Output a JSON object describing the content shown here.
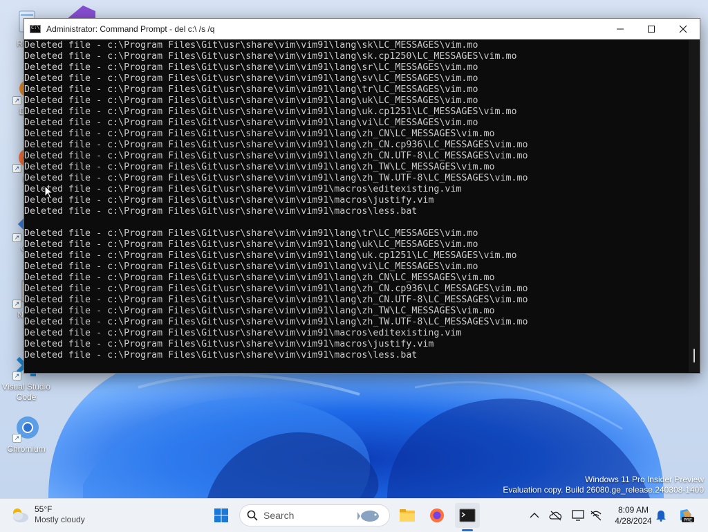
{
  "window": {
    "title": "Administrator: Command Prompt - del  c:\\ /s /q",
    "minimize_icon": "minimize-icon",
    "maximize_icon": "maximize-icon",
    "close_icon": "close-icon"
  },
  "console": {
    "lines": [
      "Deleted file - c:\\Program Files\\Git\\usr\\share\\vim\\vim91\\lang\\sk\\LC_MESSAGES\\vim.mo",
      "Deleted file - c:\\Program Files\\Git\\usr\\share\\vim\\vim91\\lang\\sk.cp1250\\LC_MESSAGES\\vim.mo",
      "Deleted file - c:\\Program Files\\Git\\usr\\share\\vim\\vim91\\lang\\sr\\LC_MESSAGES\\vim.mo",
      "Deleted file - c:\\Program Files\\Git\\usr\\share\\vim\\vim91\\lang\\sv\\LC_MESSAGES\\vim.mo",
      "Deleted file - c:\\Program Files\\Git\\usr\\share\\vim\\vim91\\lang\\tr\\LC_MESSAGES\\vim.mo",
      "Deleted file - c:\\Program Files\\Git\\usr\\share\\vim\\vim91\\lang\\uk\\LC_MESSAGES\\vim.mo",
      "Deleted file - c:\\Program Files\\Git\\usr\\share\\vim\\vim91\\lang\\uk.cp1251\\LC_MESSAGES\\vim.mo",
      "Deleted file - c:\\Program Files\\Git\\usr\\share\\vim\\vim91\\lang\\vi\\LC_MESSAGES\\vim.mo",
      "Deleted file - c:\\Program Files\\Git\\usr\\share\\vim\\vim91\\lang\\zh_CN\\LC_MESSAGES\\vim.mo",
      "Deleted file - c:\\Program Files\\Git\\usr\\share\\vim\\vim91\\lang\\zh_CN.cp936\\LC_MESSAGES\\vim.mo",
      "Deleted file - c:\\Program Files\\Git\\usr\\share\\vim\\vim91\\lang\\zh_CN.UTF-8\\LC_MESSAGES\\vim.mo",
      "Deleted file - c:\\Program Files\\Git\\usr\\share\\vim\\vim91\\lang\\zh_TW\\LC_MESSAGES\\vim.mo",
      "Deleted file - c:\\Program Files\\Git\\usr\\share\\vim\\vim91\\lang\\zh_TW.UTF-8\\LC_MESSAGES\\vim.mo",
      "Deleted file - c:\\Program Files\\Git\\usr\\share\\vim\\vim91\\macros\\editexisting.vim",
      "Deleted file - c:\\Program Files\\Git\\usr\\share\\vim\\vim91\\macros\\justify.vim",
      "Deleted file - c:\\Program Files\\Git\\usr\\share\\vim\\vim91\\macros\\less.bat",
      "",
      "Deleted file - c:\\Program Files\\Git\\usr\\share\\vim\\vim91\\lang\\tr\\LC_MESSAGES\\vim.mo",
      "Deleted file - c:\\Program Files\\Git\\usr\\share\\vim\\vim91\\lang\\uk\\LC_MESSAGES\\vim.mo",
      "Deleted file - c:\\Program Files\\Git\\usr\\share\\vim\\vim91\\lang\\uk.cp1251\\LC_MESSAGES\\vim.mo",
      "Deleted file - c:\\Program Files\\Git\\usr\\share\\vim\\vim91\\lang\\vi\\LC_MESSAGES\\vim.mo",
      "Deleted file - c:\\Program Files\\Git\\usr\\share\\vim\\vim91\\lang\\zh_CN\\LC_MESSAGES\\vim.mo",
      "Deleted file - c:\\Program Files\\Git\\usr\\share\\vim\\vim91\\lang\\zh_CN.cp936\\LC_MESSAGES\\vim.mo",
      "Deleted file - c:\\Program Files\\Git\\usr\\share\\vim\\vim91\\lang\\zh_CN.UTF-8\\LC_MESSAGES\\vim.mo",
      "Deleted file - c:\\Program Files\\Git\\usr\\share\\vim\\vim91\\lang\\zh_TW\\LC_MESSAGES\\vim.mo",
      "Deleted file - c:\\Program Files\\Git\\usr\\share\\vim\\vim91\\lang\\zh_TW.UTF-8\\LC_MESSAGES\\vim.mo",
      "Deleted file - c:\\Program Files\\Git\\usr\\share\\vim\\vim91\\macros\\editexisting.vim",
      "Deleted file - c:\\Program Files\\Git\\usr\\share\\vim\\vim91\\macros\\justify.vim",
      "Deleted file - c:\\Program Files\\Git\\usr\\share\\vim\\vim91\\macros\\less.bat"
    ]
  },
  "desktop": {
    "icons": [
      {
        "label": "Recy",
        "icon": "recycle-bin-icon"
      },
      {
        "label": "Eve",
        "icon": "everything-icon"
      },
      {
        "label": "Fi",
        "icon": "firefox-icon"
      },
      {
        "label": "Git",
        "icon": "git-icon"
      },
      {
        "label": "Note",
        "icon": "notepad-icon"
      },
      {
        "label": "Visual Studio Code",
        "icon": "vscode-icon"
      },
      {
        "label": "Chromium",
        "icon": "chromium-icon"
      }
    ]
  },
  "watermark": {
    "line1": "Windows 11 Pro Insider Preview",
    "line2": "Evaluation copy. Build 26080.ge_release.240308-1400"
  },
  "taskbar": {
    "weather": {
      "temp": "55°F",
      "condition": "Mostly cloudy",
      "icon": "cloud-sun-icon"
    },
    "start_icon": "windows-start-icon",
    "search": {
      "label": "Search",
      "icon": "search-icon"
    },
    "pinned": [
      {
        "name": "file-explorer-icon"
      },
      {
        "name": "firefox-icon"
      },
      {
        "name": "terminal-icon",
        "active": true
      }
    ],
    "tray": {
      "icons": [
        "chevron-up-icon",
        "onedrive-offline-icon",
        "display-icon",
        "wifi-off-icon"
      ],
      "time": "8:09 AM",
      "date": "4/28/2024",
      "notification_icon": "bell-icon",
      "copilot_icon": "copilot-icon",
      "copilot_badge": "PRE"
    }
  },
  "colors": {
    "console_bg": "#0c0c0c",
    "console_fg": "#cccccc",
    "accent": "#1a6fd8"
  }
}
